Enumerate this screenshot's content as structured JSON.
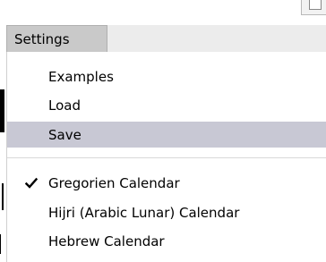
{
  "menubar": {
    "active_menu": "Settings"
  },
  "menu": {
    "items": [
      {
        "label": "Examples",
        "highlighted": false
      },
      {
        "label": "Load",
        "highlighted": false
      },
      {
        "label": "Save",
        "highlighted": true
      }
    ],
    "calendar_items": [
      {
        "label": "Gregorien Calendar",
        "checked": true
      },
      {
        "label": "Hijri (Arabic Lunar) Calendar",
        "checked": false
      },
      {
        "label": "Hebrew Calendar",
        "checked": false
      }
    ]
  },
  "icons": {
    "check": "check-icon"
  },
  "colors": {
    "menu_highlight": "#c8c8d4",
    "menubar_active": "#c9c9c9"
  }
}
